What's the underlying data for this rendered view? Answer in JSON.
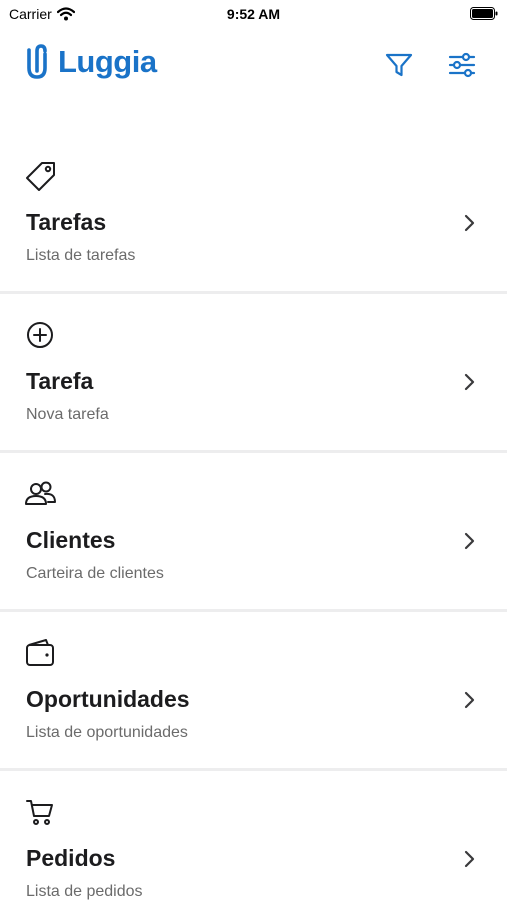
{
  "status_bar": {
    "carrier": "Carrier",
    "time": "9:52 AM"
  },
  "header": {
    "logo_text": "Luggia",
    "brand_color": "#1a73c8",
    "filter_icon": "filter-icon",
    "settings_icon": "sliders-icon"
  },
  "menu": {
    "items": [
      {
        "icon": "tag-icon",
        "title": "Tarefas",
        "subtitle": "Lista de tarefas"
      },
      {
        "icon": "plus-circle-icon",
        "title": "Tarefa",
        "subtitle": "Nova tarefa"
      },
      {
        "icon": "users-icon",
        "title": "Clientes",
        "subtitle": "Carteira de clientes"
      },
      {
        "icon": "wallet-icon",
        "title": "Oportunidades",
        "subtitle": "Lista de oportunidades"
      },
      {
        "icon": "cart-icon",
        "title": "Pedidos",
        "subtitle": "Lista de pedidos"
      }
    ]
  }
}
